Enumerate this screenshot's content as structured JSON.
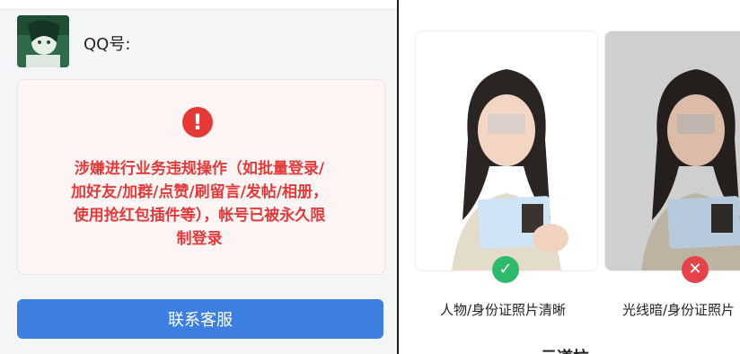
{
  "account": {
    "label": "QQ号:"
  },
  "warning": {
    "message": "涉嫌进行业务违规操作（如批量登录/\n加好友/加群/点赞/刷留言/发帖/相册，\n使用抢红包插件等），帐号已被永久限\n制登录",
    "icon": "exclamation-icon"
  },
  "contact_button": {
    "label": "联系客服"
  },
  "examples": [
    {
      "caption": "人物/身份证照片清晰",
      "status_icon": "check-icon",
      "status_color": "#2fb96b"
    },
    {
      "caption": "光线暗/身份证照片",
      "status_icon": "close-icon",
      "status_color": "#e5434a"
    }
  ],
  "partial_heading": "示道拉"
}
